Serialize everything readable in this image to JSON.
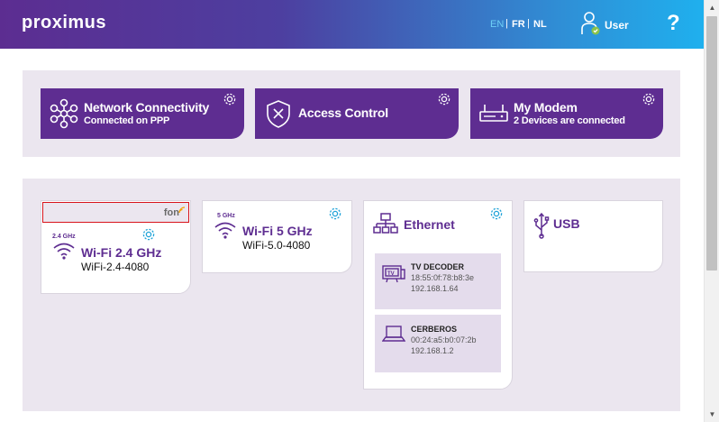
{
  "header": {
    "logo": "proximus",
    "languages": [
      "EN",
      "FR",
      "NL"
    ],
    "active_language": "EN",
    "user_label": "User",
    "help_symbol": "?"
  },
  "tiles": [
    {
      "title": "Network Connectivity",
      "subtitle": "Connected on PPP",
      "icon": "network-icon"
    },
    {
      "title": "Access Control",
      "subtitle": "",
      "icon": "shield-icon"
    },
    {
      "title": "My Modem",
      "subtitle": "2 Devices are connected",
      "icon": "modem-icon"
    }
  ],
  "wifi24": {
    "band_badge": "2.4 GHz",
    "title": "Wi-Fi 2.4 GHz",
    "ssid": "WiFi-2.4-4080",
    "fon_label": "fon"
  },
  "wifi5": {
    "band_badge": "5 GHz",
    "title": "Wi-Fi 5 GHz",
    "ssid": "WiFi-5.0-4080"
  },
  "ethernet": {
    "title": "Ethernet",
    "devices": [
      {
        "name": "TV DECODER",
        "mac": "18:55:0f:78:b8:3e",
        "ip": "192.168.1.64",
        "icon": "tv-icon"
      },
      {
        "name": "CERBEROS",
        "mac": "00:24:a5:b0:07:2b",
        "ip": "192.168.1.2",
        "icon": "laptop-icon"
      }
    ]
  },
  "usb": {
    "title": "USB"
  },
  "colors": {
    "brand_purple": "#5e2d91",
    "accent_blue": "#1fb0ee",
    "panel_bg": "#ebe6ef"
  }
}
